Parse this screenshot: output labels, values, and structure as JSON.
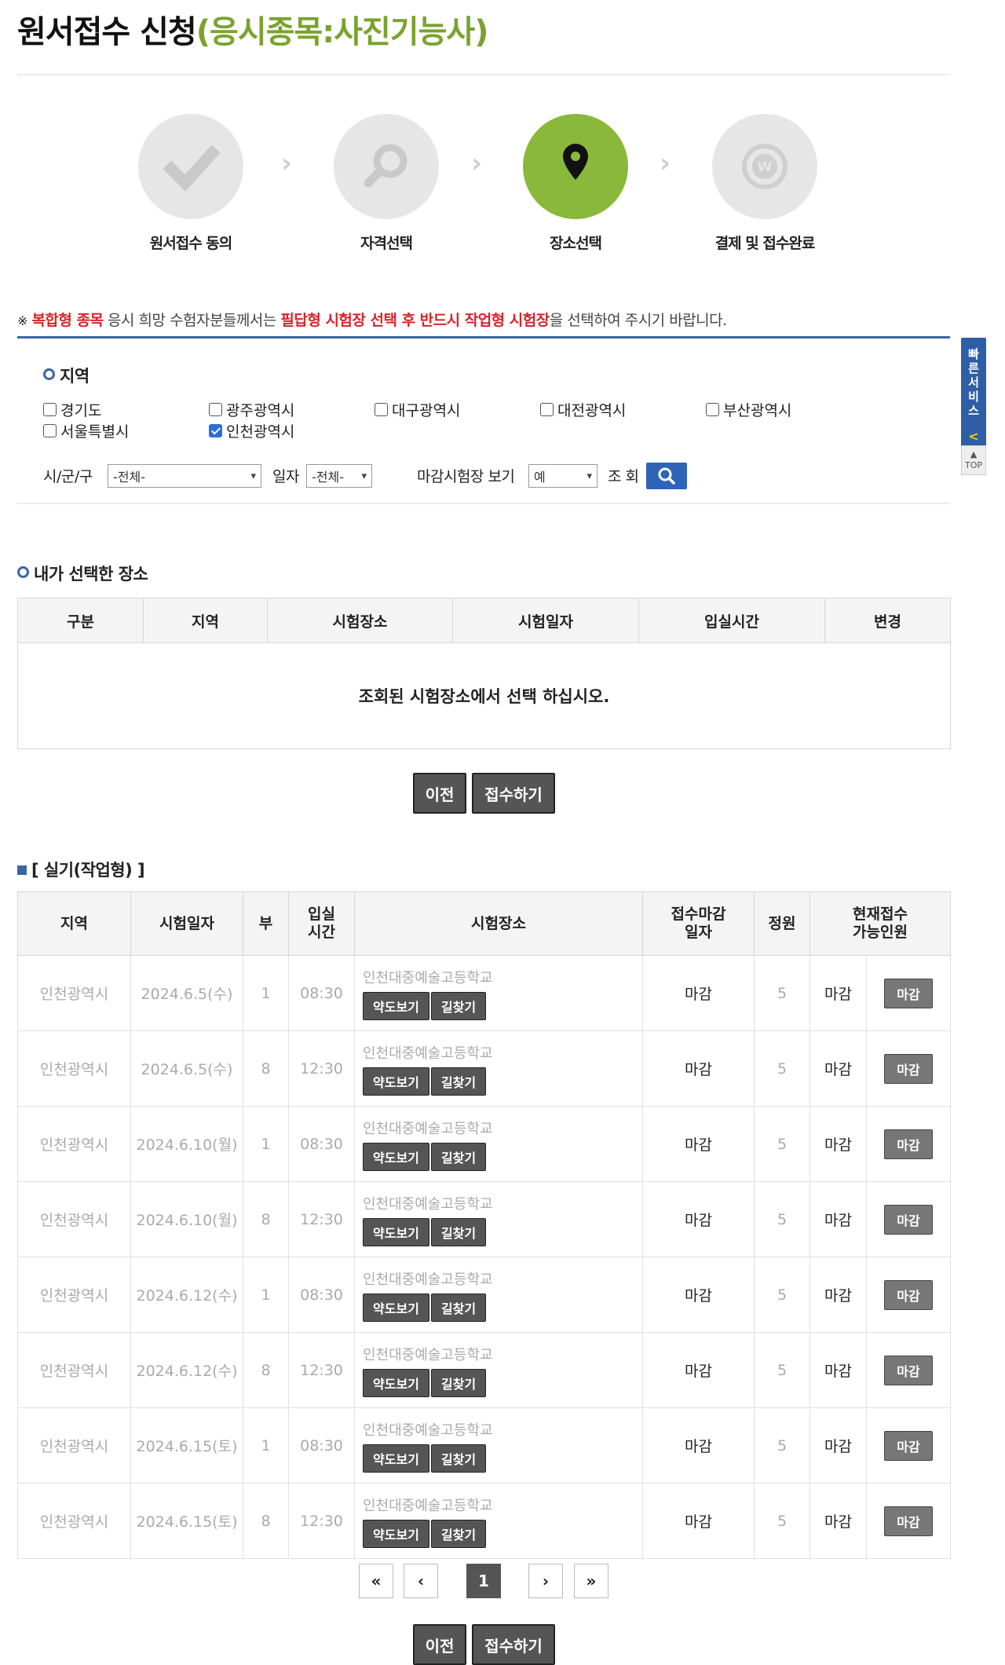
{
  "title": {
    "main": "원서접수 신청",
    "accent": "(응시종목:사진기능사)"
  },
  "steps": [
    {
      "label": "원서접수 동의",
      "icon": "check-icon"
    },
    {
      "label": "자격선택",
      "icon": "search-icon"
    },
    {
      "label": "장소선택",
      "icon": "location-pin-icon"
    },
    {
      "label": "결제 및 접수완료",
      "icon": "won-coin-icon"
    }
  ],
  "notice": {
    "mark": "※",
    "red1": "복합형 종목",
    "t1": " 응시 희망 수험자분들께서는 ",
    "red2": "필답형 시험장 선택 후 반드시 작업형 시험장",
    "t2": "을 선택하여 주시기 바랍니다."
  },
  "region": {
    "heading": "지역",
    "options": [
      {
        "label": "경기도",
        "checked": false
      },
      {
        "label": "광주광역시",
        "checked": false
      },
      {
        "label": "대구광역시",
        "checked": false
      },
      {
        "label": "대전광역시",
        "checked": false
      },
      {
        "label": "부산광역시",
        "checked": false
      },
      {
        "label": "서울특별시",
        "checked": false
      },
      {
        "label": "인천광역시",
        "checked": true
      }
    ]
  },
  "filters": {
    "city_label": "시/군/구",
    "city_value": "-전체-",
    "date_label": "일자",
    "date_value": "-전체-",
    "closed_label": "마감시험장 보기",
    "closed_value": "예",
    "search_label": "조 회"
  },
  "selected": {
    "heading": "내가 선택한 장소",
    "headers": [
      "구분",
      "지역",
      "시험장소",
      "시험일자",
      "입실시간",
      "변경"
    ],
    "empty": "조회된 시험장소에서 선택 하십시오."
  },
  "buttons": {
    "prev": "이전",
    "submit": "접수하기"
  },
  "practical": {
    "heading": "[ 실기(작업형) ]",
    "headers": {
      "region": "지역",
      "date": "시험일자",
      "part": "부",
      "entry1": "입실",
      "entry2": "시간",
      "place": "시험장소",
      "deadline1": "접수마감",
      "deadline2": "일자",
      "capacity": "정원",
      "current1": "현재접수",
      "current2": "가능인원"
    },
    "map_label": "약도보기",
    "directions_label": "길찾기",
    "rows": [
      {
        "region": "인천광역시",
        "date": "2024.6.5(수)",
        "part": "1",
        "time": "08:30",
        "place": "인천대중예술고등학교",
        "deadline": "마감",
        "capacity": "5",
        "status": "마감",
        "action": "마감"
      },
      {
        "region": "인천광역시",
        "date": "2024.6.5(수)",
        "part": "8",
        "time": "12:30",
        "place": "인천대중예술고등학교",
        "deadline": "마감",
        "capacity": "5",
        "status": "마감",
        "action": "마감"
      },
      {
        "region": "인천광역시",
        "date": "2024.6.10(월)",
        "part": "1",
        "time": "08:30",
        "place": "인천대중예술고등학교",
        "deadline": "마감",
        "capacity": "5",
        "status": "마감",
        "action": "마감"
      },
      {
        "region": "인천광역시",
        "date": "2024.6.10(월)",
        "part": "8",
        "time": "12:30",
        "place": "인천대중예술고등학교",
        "deadline": "마감",
        "capacity": "5",
        "status": "마감",
        "action": "마감"
      },
      {
        "region": "인천광역시",
        "date": "2024.6.12(수)",
        "part": "1",
        "time": "08:30",
        "place": "인천대중예술고등학교",
        "deadline": "마감",
        "capacity": "5",
        "status": "마감",
        "action": "마감"
      },
      {
        "region": "인천광역시",
        "date": "2024.6.12(수)",
        "part": "8",
        "time": "12:30",
        "place": "인천대중예술고등학교",
        "deadline": "마감",
        "capacity": "5",
        "status": "마감",
        "action": "마감"
      },
      {
        "region": "인천광역시",
        "date": "2024.6.15(토)",
        "part": "1",
        "time": "08:30",
        "place": "인천대중예술고등학교",
        "deadline": "마감",
        "capacity": "5",
        "status": "마감",
        "action": "마감"
      },
      {
        "region": "인천광역시",
        "date": "2024.6.15(토)",
        "part": "8",
        "time": "12:30",
        "place": "인천대중예술고등학교",
        "deadline": "마감",
        "capacity": "5",
        "status": "마감",
        "action": "마감"
      }
    ]
  },
  "pagination": {
    "first": "«",
    "prev": "‹",
    "current": "1",
    "next": "›",
    "last": "»"
  },
  "quick": {
    "label": "빠른서비스",
    "collapse": "<",
    "top": "TOP"
  }
}
